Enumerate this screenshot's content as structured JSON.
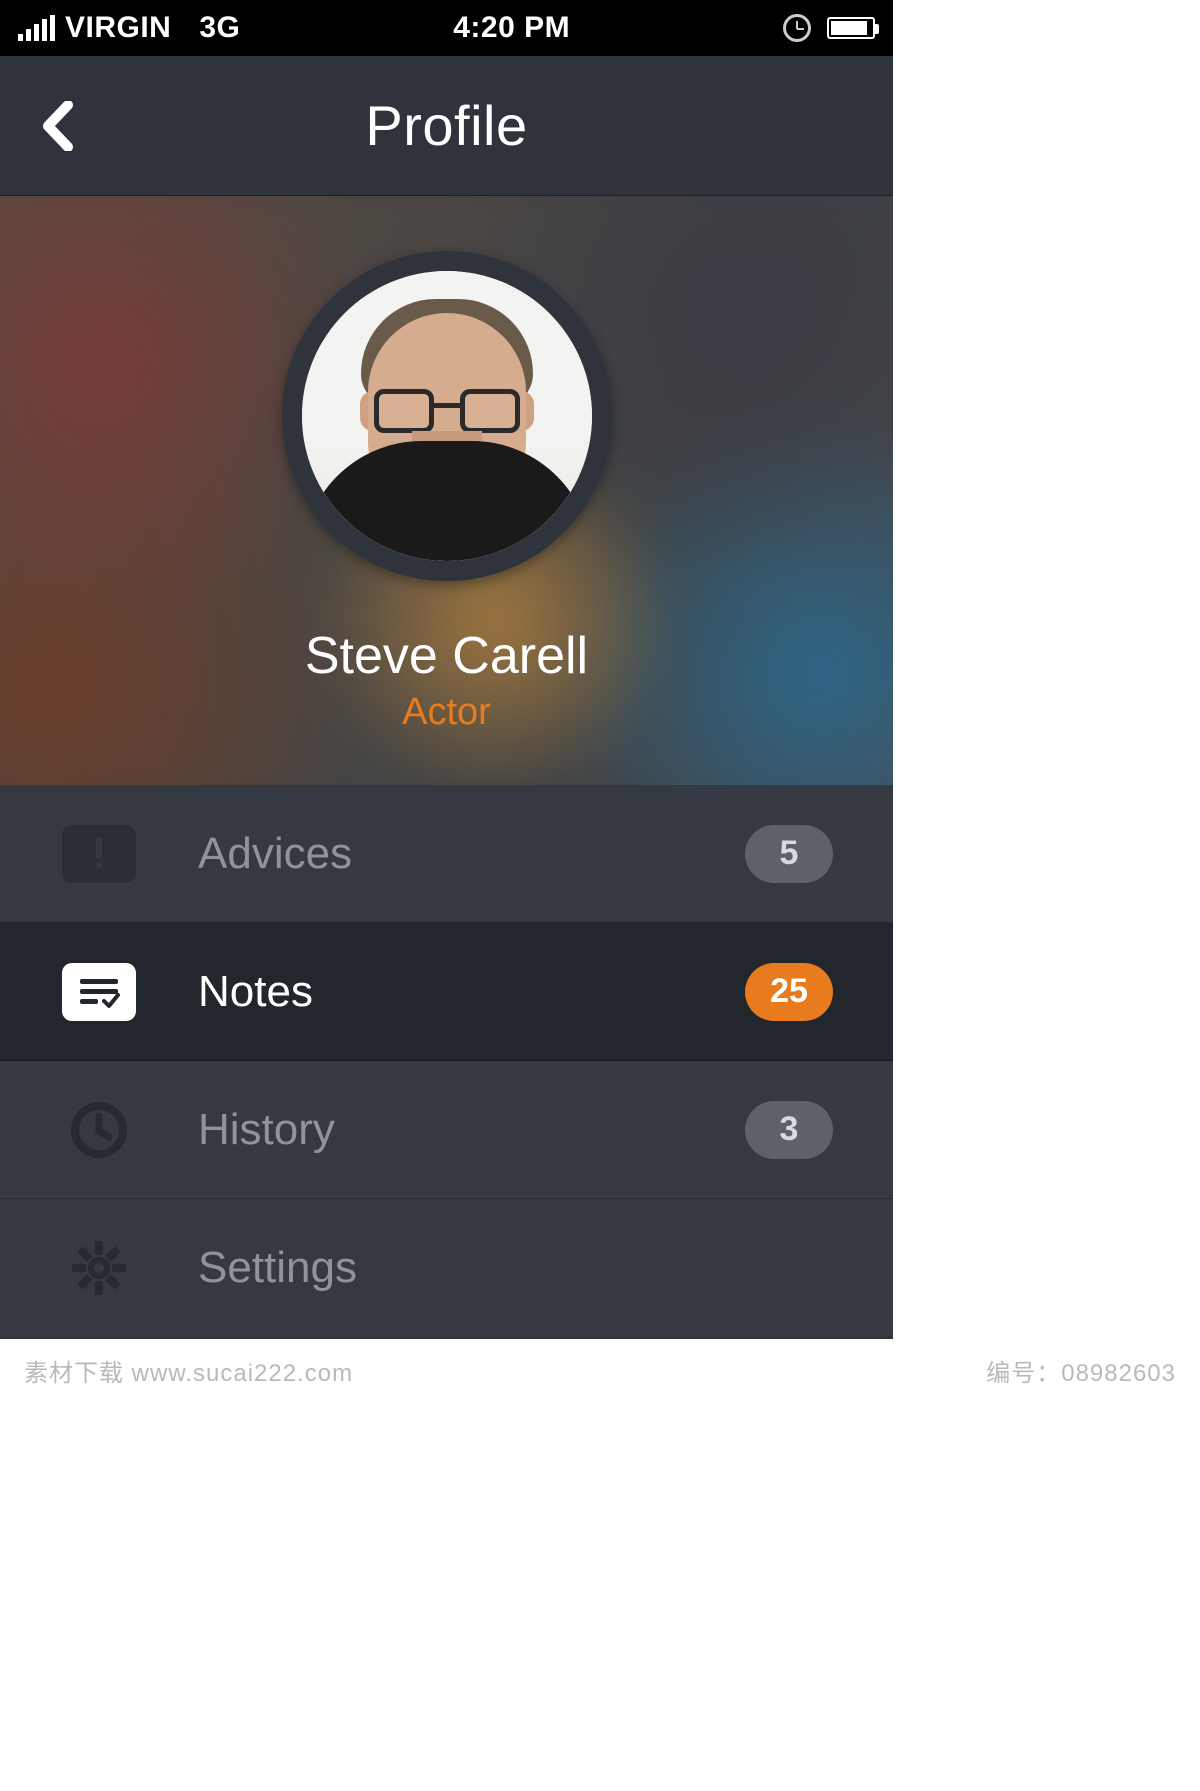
{
  "status": {
    "carrier": "VIRGIN",
    "network": "3G",
    "time": "4:20 PM"
  },
  "header": {
    "title": "Profile"
  },
  "profile": {
    "name": "Steve Carell",
    "role": "Actor"
  },
  "menu": {
    "advices": {
      "label": "Advices",
      "count": "5"
    },
    "notes": {
      "label": "Notes",
      "count": "25"
    },
    "history": {
      "label": "History",
      "count": "3"
    },
    "settings": {
      "label": "Settings"
    }
  },
  "watermark": {
    "left_cn": "素材下载",
    "left_url": "www.sucai222.com",
    "right_label": "编号：",
    "right_id": "08982603"
  }
}
